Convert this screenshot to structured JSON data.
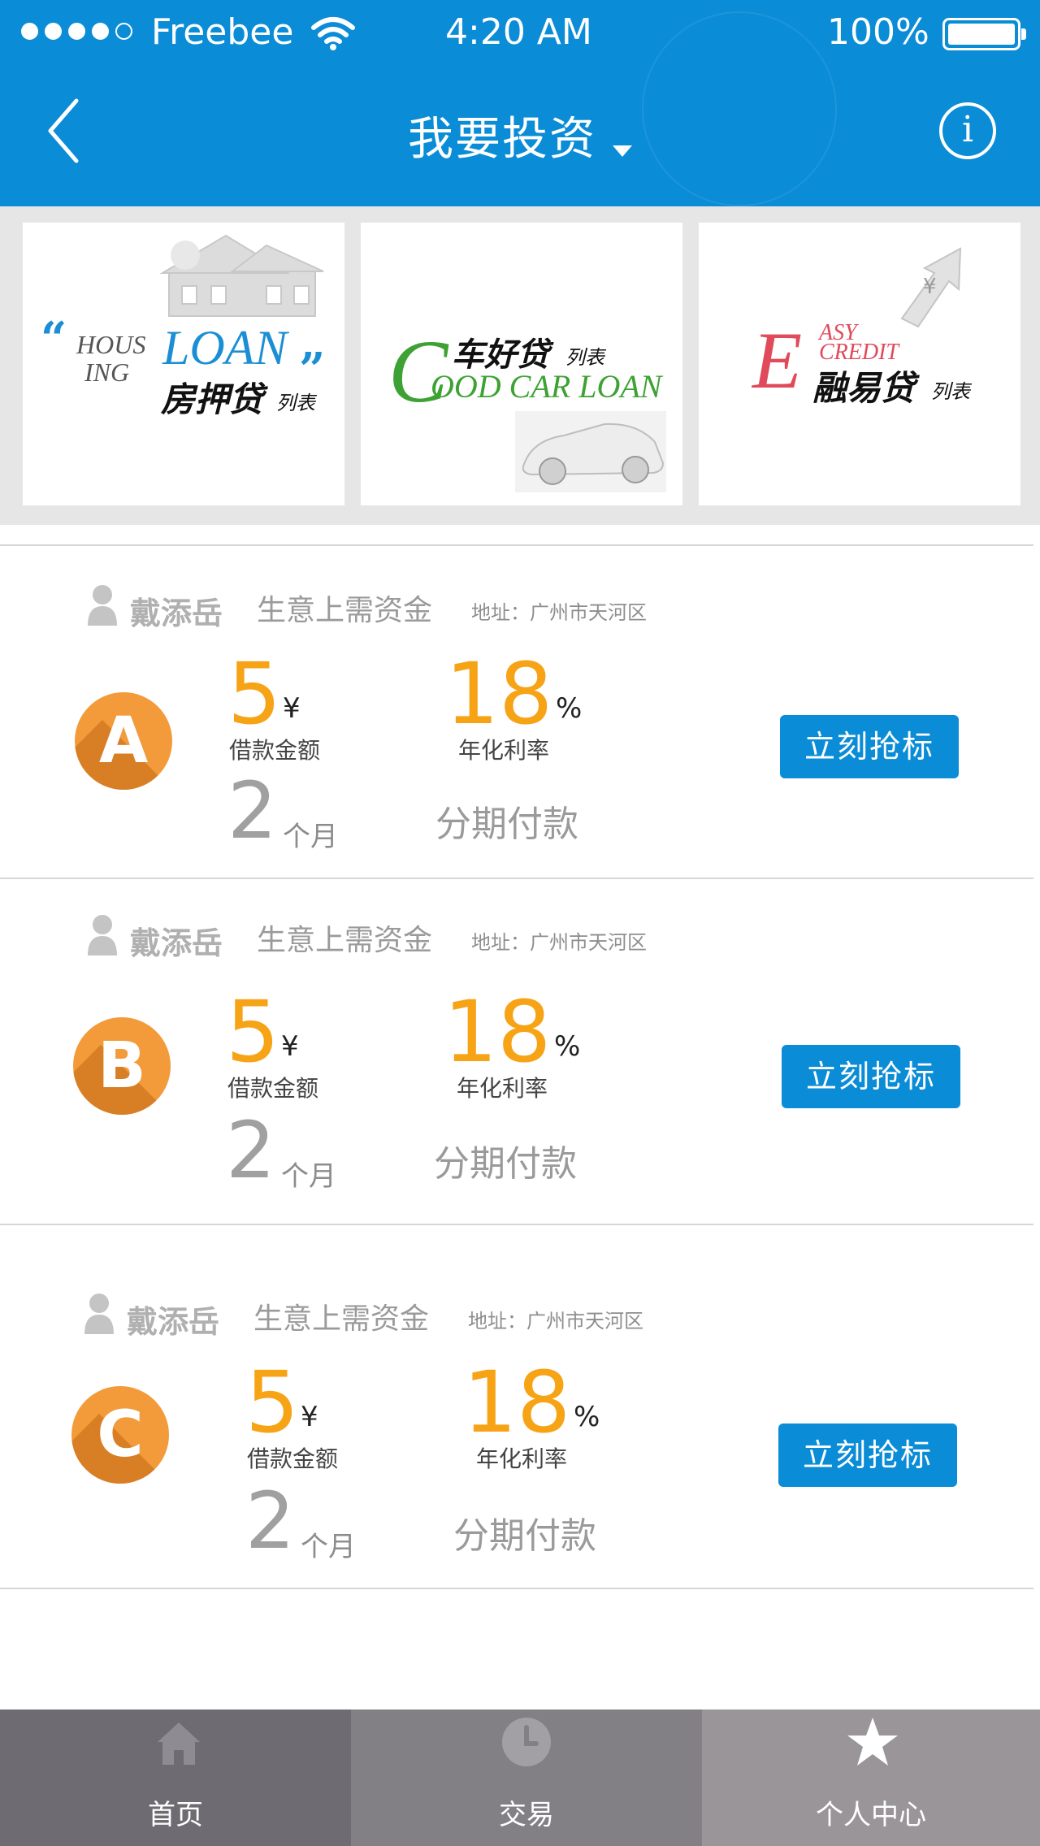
{
  "status_bar": {
    "carrier": "Freebee",
    "time": "4:20 AM",
    "battery": "100%"
  },
  "header": {
    "title": "我要投资",
    "back_icon": "chevron-left-icon",
    "info_icon": "info-icon",
    "info_glyph": "i"
  },
  "banner": {
    "cards": [
      {
        "name": "housing-loan",
        "quote_open": "“",
        "en_a": "HOUS",
        "en_b": "ING",
        "en_c": "LOAN",
        "quote_close": "”",
        "zh": "房押贷",
        "list": "列表"
      },
      {
        "name": "good-car-loan",
        "initial": "C",
        "zh": "车好贷",
        "list": "列表",
        "en": "OOD CAR LOAN"
      },
      {
        "name": "easy-credit",
        "initial": "E",
        "en_a": "ASY",
        "en_b": "CREDIT",
        "zh": "融易贷",
        "list": "列表",
        "symbol": "¥"
      }
    ]
  },
  "loans": [
    {
      "badge": "A",
      "name": "戴添岳",
      "purpose": "生意上需资金",
      "address": "地址：广州市天河区",
      "amount": "5",
      "amount_unit": "¥",
      "amount_label": "借款金额",
      "rate": "18",
      "rate_unit": "%",
      "rate_label": "年化利率",
      "term": "2",
      "term_unit": "个月",
      "payment": "分期付款",
      "button": "立刻抢标"
    },
    {
      "badge": "B",
      "name": "戴添岳",
      "purpose": "生意上需资金",
      "address": "地址：广州市天河区",
      "amount": "5",
      "amount_unit": "¥",
      "amount_label": "借款金额",
      "rate": "18",
      "rate_unit": "%",
      "rate_label": "年化利率",
      "term": "2",
      "term_unit": "个月",
      "payment": "分期付款",
      "button": "立刻抢标"
    },
    {
      "badge": "C",
      "name": "戴添岳",
      "purpose": "生意上需资金",
      "address": "地址：广州市天河区",
      "amount": "5",
      "amount_unit": "¥",
      "amount_label": "借款金额",
      "rate": "18",
      "rate_unit": "%",
      "rate_label": "年化利率",
      "term": "2",
      "term_unit": "个月",
      "payment": "分期付款",
      "button": "立刻抢标"
    }
  ],
  "tabbar": {
    "tabs": [
      {
        "label": "首页",
        "icon": "home-icon",
        "bg": "#6E6C72"
      },
      {
        "label": "交易",
        "icon": "clock-icon",
        "bg": "#838085"
      },
      {
        "label": "个人中心",
        "icon": "star-icon",
        "bg": "#9A9598"
      }
    ]
  },
  "colors": {
    "brand_blue": "#0A8CD7",
    "accent_orange": "#F7A316",
    "badge_orange": "#F39A3A"
  }
}
